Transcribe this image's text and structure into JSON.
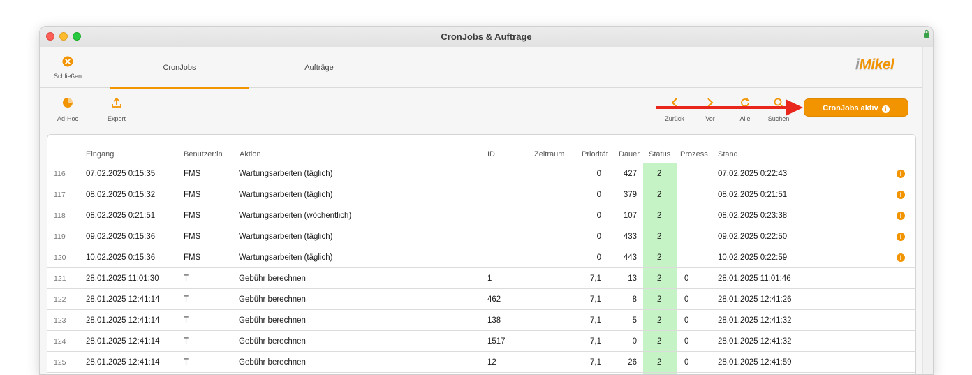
{
  "window": {
    "title": "CronJobs & Aufträge"
  },
  "topbar": {
    "close_label": "Schließen",
    "tabs": [
      {
        "label": "CronJobs",
        "active": true
      },
      {
        "label": "Aufträge",
        "active": false
      }
    ],
    "logo_prefix": "i",
    "logo_rest": "Mikel"
  },
  "toolbar": {
    "adhoc_label": "Ad-Hoc",
    "export_label": "Export",
    "back_label": "Zurück",
    "next_label": "Vor",
    "all_label": "Alle",
    "search_label": "Suchen",
    "cronjobs_active_label": "CronJobs aktiv"
  },
  "table": {
    "headers": [
      "Eingang",
      "Benutzer:in",
      "Aktion",
      "ID",
      "Zeitraum",
      "Priorität",
      "Dauer",
      "Status",
      "Prozess",
      "Stand"
    ],
    "rows": [
      {
        "nr": "116",
        "eingang": "07.02.2025 0:15:35",
        "user": "FMS",
        "aktion": "Wartungsarbeiten (täglich)",
        "id": "",
        "zeitraum": "",
        "prio": "0",
        "dauer": "427",
        "status": "2",
        "prozess": "",
        "stand": "07.02.2025 0:22:43",
        "info": true
      },
      {
        "nr": "117",
        "eingang": "08.02.2025 0:15:32",
        "user": "FMS",
        "aktion": "Wartungsarbeiten (täglich)",
        "id": "",
        "zeitraum": "",
        "prio": "0",
        "dauer": "379",
        "status": "2",
        "prozess": "",
        "stand": "08.02.2025 0:21:51",
        "info": true
      },
      {
        "nr": "118",
        "eingang": "08.02.2025 0:21:51",
        "user": "FMS",
        "aktion": "Wartungsarbeiten (wöchentlich)",
        "id": "",
        "zeitraum": "",
        "prio": "0",
        "dauer": "107",
        "status": "2",
        "prozess": "",
        "stand": "08.02.2025 0:23:38",
        "info": true
      },
      {
        "nr": "119",
        "eingang": "09.02.2025 0:15:36",
        "user": "FMS",
        "aktion": "Wartungsarbeiten (täglich)",
        "id": "",
        "zeitraum": "",
        "prio": "0",
        "dauer": "433",
        "status": "2",
        "prozess": "",
        "stand": "09.02.2025 0:22:50",
        "info": true
      },
      {
        "nr": "120",
        "eingang": "10.02.2025 0:15:36",
        "user": "FMS",
        "aktion": "Wartungsarbeiten (täglich)",
        "id": "",
        "zeitraum": "",
        "prio": "0",
        "dauer": "443",
        "status": "2",
        "prozess": "",
        "stand": "10.02.2025 0:22:59",
        "info": true
      },
      {
        "nr": "121",
        "eingang": "28.01.2025 11:01:30",
        "user": "T",
        "aktion": "Gebühr berechnen",
        "id": "1",
        "zeitraum": "",
        "prio": "7,1",
        "dauer": "13",
        "status": "2",
        "prozess": "0",
        "stand": "28.01.2025 11:01:46",
        "info": false
      },
      {
        "nr": "122",
        "eingang": "28.01.2025 12:41:14",
        "user": "T",
        "aktion": "Gebühr berechnen",
        "id": "462",
        "zeitraum": "",
        "prio": "7,1",
        "dauer": "8",
        "status": "2",
        "prozess": "0",
        "stand": "28.01.2025 12:41:26",
        "info": false
      },
      {
        "nr": "123",
        "eingang": "28.01.2025 12:41:14",
        "user": "T",
        "aktion": "Gebühr berechnen",
        "id": "138",
        "zeitraum": "",
        "prio": "7,1",
        "dauer": "5",
        "status": "2",
        "prozess": "0",
        "stand": "28.01.2025 12:41:32",
        "info": false
      },
      {
        "nr": "124",
        "eingang": "28.01.2025 12:41:14",
        "user": "T",
        "aktion": "Gebühr berechnen",
        "id": "1517",
        "zeitraum": "",
        "prio": "7,1",
        "dauer": "0",
        "status": "2",
        "prozess": "0",
        "stand": "28.01.2025 12:41:32",
        "info": false
      },
      {
        "nr": "125",
        "eingang": "28.01.2025 12:41:14",
        "user": "T",
        "aktion": "Gebühr berechnen",
        "id": "12",
        "zeitraum": "",
        "prio": "7,1",
        "dauer": "26",
        "status": "2",
        "prozess": "0",
        "stand": "28.01.2025 12:41:59",
        "info": false
      }
    ]
  },
  "colors": {
    "accent": "#f29400",
    "status_bg": "#c5f3c5",
    "arrow": "#e8261b"
  },
  "icons": [
    "close-circle-icon",
    "pie-chart-icon",
    "upload-icon",
    "chevron-left-icon",
    "chevron-right-icon",
    "refresh-icon",
    "search-icon",
    "info-icon",
    "lock-icon"
  ]
}
